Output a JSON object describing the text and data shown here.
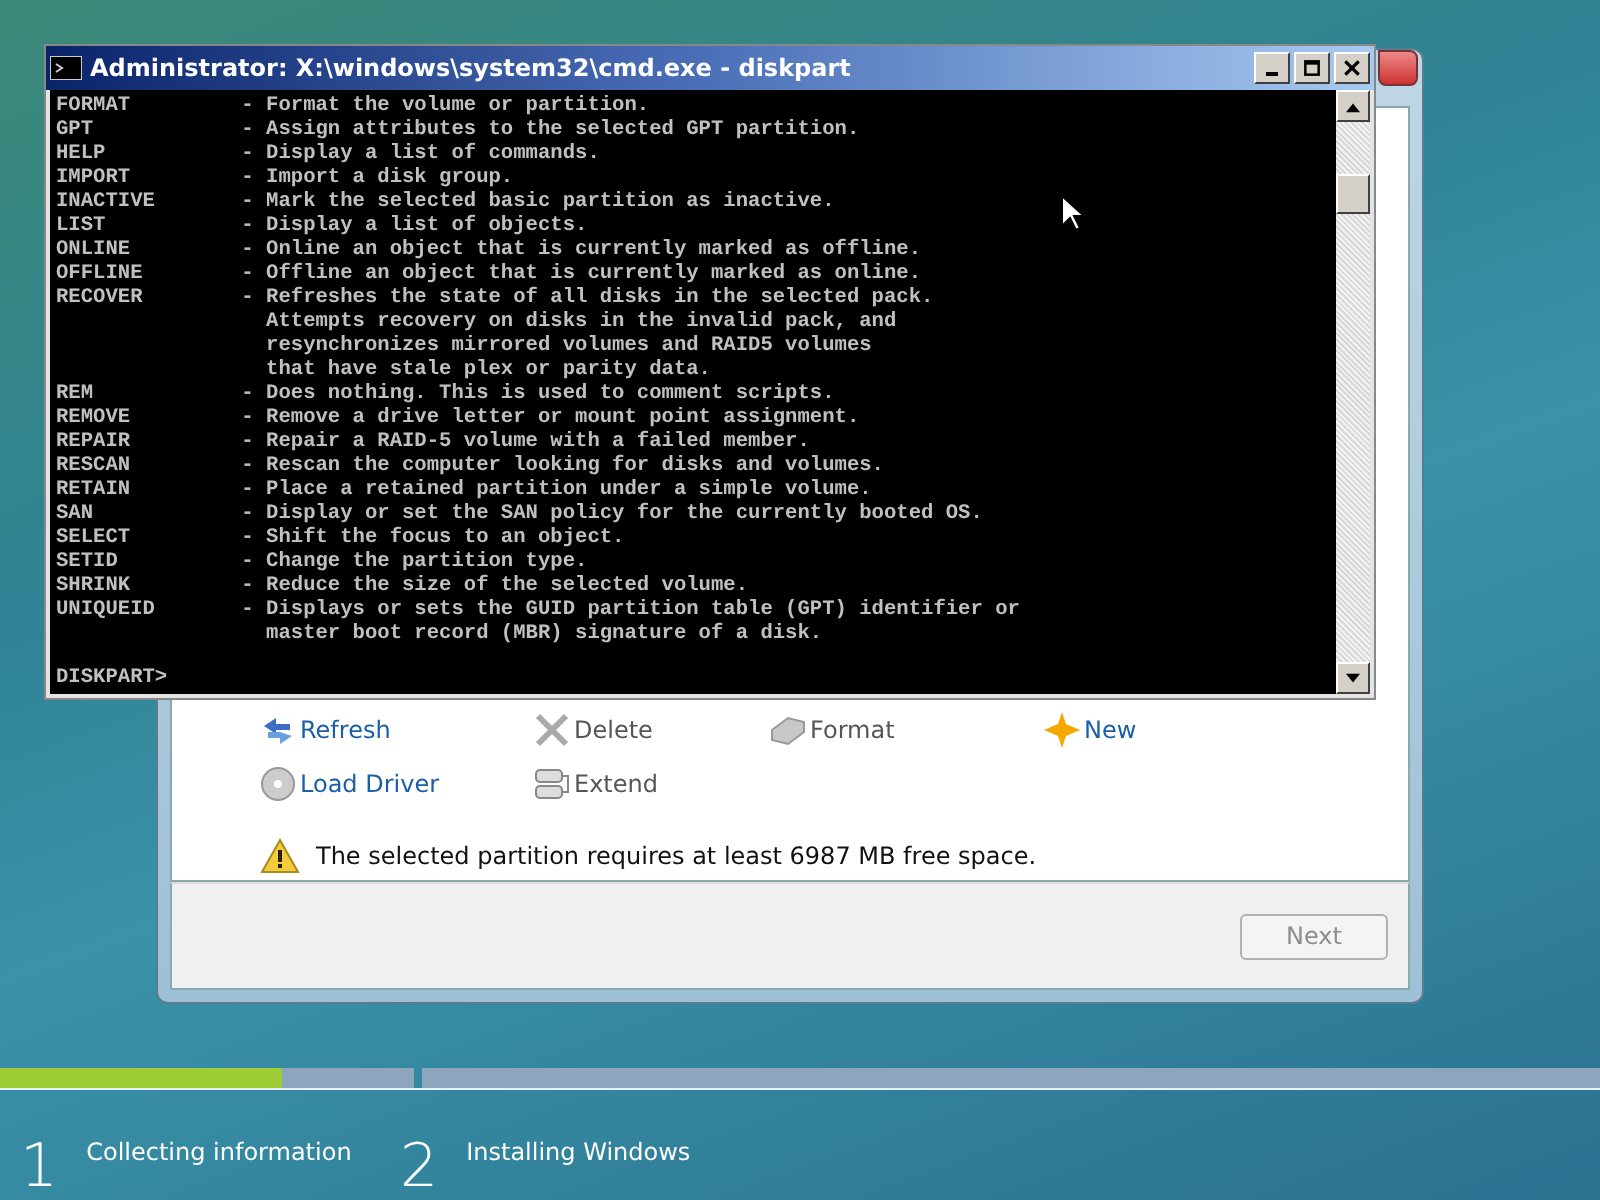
{
  "setup_window": {
    "actions": [
      {
        "kind": "refresh",
        "label": "Refresh",
        "disabled": false
      },
      {
        "kind": "delete",
        "label": "Delete",
        "disabled": true
      },
      {
        "kind": "format",
        "label": "Format",
        "disabled": true
      },
      {
        "kind": "new",
        "label": "New",
        "disabled": false
      },
      {
        "kind": "load",
        "label": "Load Driver",
        "disabled": false
      },
      {
        "kind": "extend",
        "label": "Extend",
        "disabled": true
      }
    ],
    "warning": "The selected partition requires at least 6987 MB free space.",
    "next_button": {
      "label": "Next",
      "disabled": true
    }
  },
  "console_window": {
    "title": "Administrator: X:\\windows\\system32\\cmd.exe - diskpart",
    "lines": [
      {
        "command": "FORMAT",
        "description": [
          "- Format the volume or partition."
        ]
      },
      {
        "command": "GPT",
        "description": [
          "- Assign attributes to the selected GPT partition."
        ]
      },
      {
        "command": "HELP",
        "description": [
          "- Display a list of commands."
        ]
      },
      {
        "command": "IMPORT",
        "description": [
          "- Import a disk group."
        ]
      },
      {
        "command": "INACTIVE",
        "description": [
          "- Mark the selected basic partition as inactive."
        ]
      },
      {
        "command": "LIST",
        "description": [
          "- Display a list of objects."
        ]
      },
      {
        "command": "ONLINE",
        "description": [
          "- Online an object that is currently marked as offline."
        ]
      },
      {
        "command": "OFFLINE",
        "description": [
          "- Offline an object that is currently marked as online."
        ]
      },
      {
        "command": "RECOVER",
        "description": [
          "- Refreshes the state of all disks in the selected pack.",
          "  Attempts recovery on disks in the invalid pack, and",
          "  resynchronizes mirrored volumes and RAID5 volumes",
          "  that have stale plex or parity data."
        ]
      },
      {
        "command": "REM",
        "description": [
          "- Does nothing. This is used to comment scripts."
        ]
      },
      {
        "command": "REMOVE",
        "description": [
          "- Remove a drive letter or mount point assignment."
        ]
      },
      {
        "command": "REPAIR",
        "description": [
          "- Repair a RAID-5 volume with a failed member."
        ]
      },
      {
        "command": "RESCAN",
        "description": [
          "- Rescan the computer looking for disks and volumes."
        ]
      },
      {
        "command": "RETAIN",
        "description": [
          "- Place a retained partition under a simple volume."
        ]
      },
      {
        "command": "SAN",
        "description": [
          "- Display or set the SAN policy for the currently booted OS."
        ]
      },
      {
        "command": "SELECT",
        "description": [
          "- Shift the focus to an object."
        ]
      },
      {
        "command": "SETID",
        "description": [
          "- Change the partition type."
        ]
      },
      {
        "command": "SHRINK",
        "description": [
          "- Reduce the size of the selected volume."
        ]
      },
      {
        "command": "UNIQUEID",
        "description": [
          "- Displays or sets the GUID partition table (GPT) identifier or",
          "  master boot record (MBR) signature of a disk."
        ]
      }
    ],
    "prompt": "DISKPART>"
  },
  "progress": {
    "steps": [
      {
        "number": "1",
        "label": "Collecting information",
        "level": 0.68
      },
      {
        "number": "2",
        "label": "Installing Windows"
      }
    ]
  }
}
